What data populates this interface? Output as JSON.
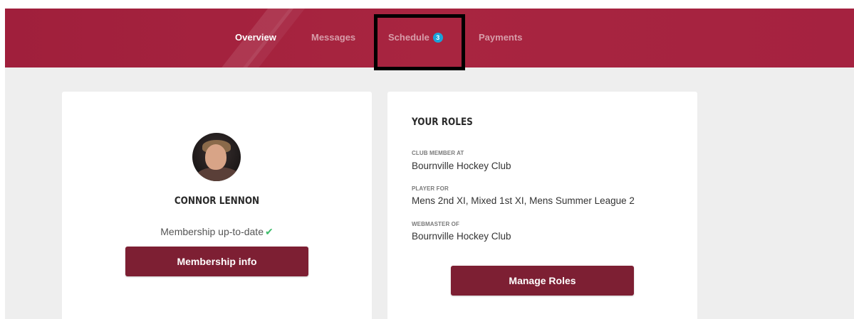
{
  "nav": {
    "overview": "Overview",
    "messages": "Messages",
    "schedule": "Schedule",
    "schedule_badge": "3",
    "payments": "Payments"
  },
  "profile": {
    "name": "CONNOR LENNON",
    "membership_status": "Membership up-to-date",
    "status_icon": "check-icon",
    "membership_button": "Membership info"
  },
  "roles": {
    "title": "YOUR ROLES",
    "items": [
      {
        "label": "CLUB MEMBER AT",
        "value": "Bournville Hockey Club"
      },
      {
        "label": "PLAYER FOR",
        "value": "Mens 2nd XI, Mixed 1st XI, Mens Summer League 2"
      },
      {
        "label": "WEBMASTER OF",
        "value": "Bournville Hockey Club"
      }
    ],
    "manage_button": "Manage Roles"
  },
  "colors": {
    "header": "#a52240",
    "button": "#7d1f33",
    "badge": "#1aa3d9",
    "check": "#3dbb6a"
  }
}
